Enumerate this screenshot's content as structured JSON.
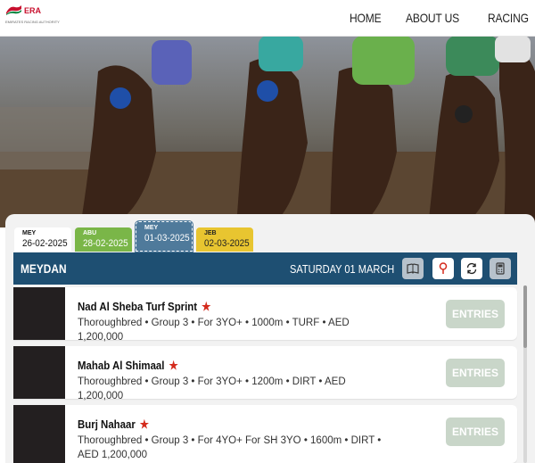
{
  "header": {
    "logo_text": "ERA",
    "logo_subtext": "EMIRATES RACING AUTHORITY",
    "nav": [
      "HOME",
      "ABOUT US",
      "RACING"
    ]
  },
  "tabs": [
    {
      "code": "MEY",
      "date": "26-02-2025",
      "color": "#ffffff",
      "text_color": "#111111",
      "active": false
    },
    {
      "code": "ABU",
      "date": "28-02-2025",
      "color": "#7ab648",
      "text_color": "#ffffff",
      "active": false
    },
    {
      "code": "MEY",
      "date": "01-03-2025",
      "color": "#4f7a9b",
      "text_color": "#ffffff",
      "active": true
    },
    {
      "code": "JEB",
      "date": "02-03-2025",
      "color": "#e8c530",
      "text_color": "#222222",
      "active": false
    }
  ],
  "venue": {
    "name": "MEYDAN",
    "date": "SATURDAY 01 MARCH",
    "bar_color": "#1e4f72",
    "buttons": [
      "book-icon",
      "location-pin-icon",
      "refresh-icon",
      "calculator-icon"
    ]
  },
  "races": [
    {
      "name": "Nad Al Sheba Turf Sprint",
      "info": "Thoroughbred • Group 3 • For 3YO+ • 1000m • TURF • AED 1,200,000",
      "button": "ENTRIES"
    },
    {
      "name": "Mahab Al Shimaal",
      "info": "Thoroughbred • Group 3 • For 3YO+ • 1200m • DIRT • AED 1,200,000",
      "button": "ENTRIES"
    },
    {
      "name": "Burj Nahaar",
      "info": "Thoroughbred • Group 3 • For 4YO+ For SH 3YO • 1600m • DIRT • AED 1,200,000",
      "button": "ENTRIES"
    }
  ],
  "star_glyph": "★"
}
